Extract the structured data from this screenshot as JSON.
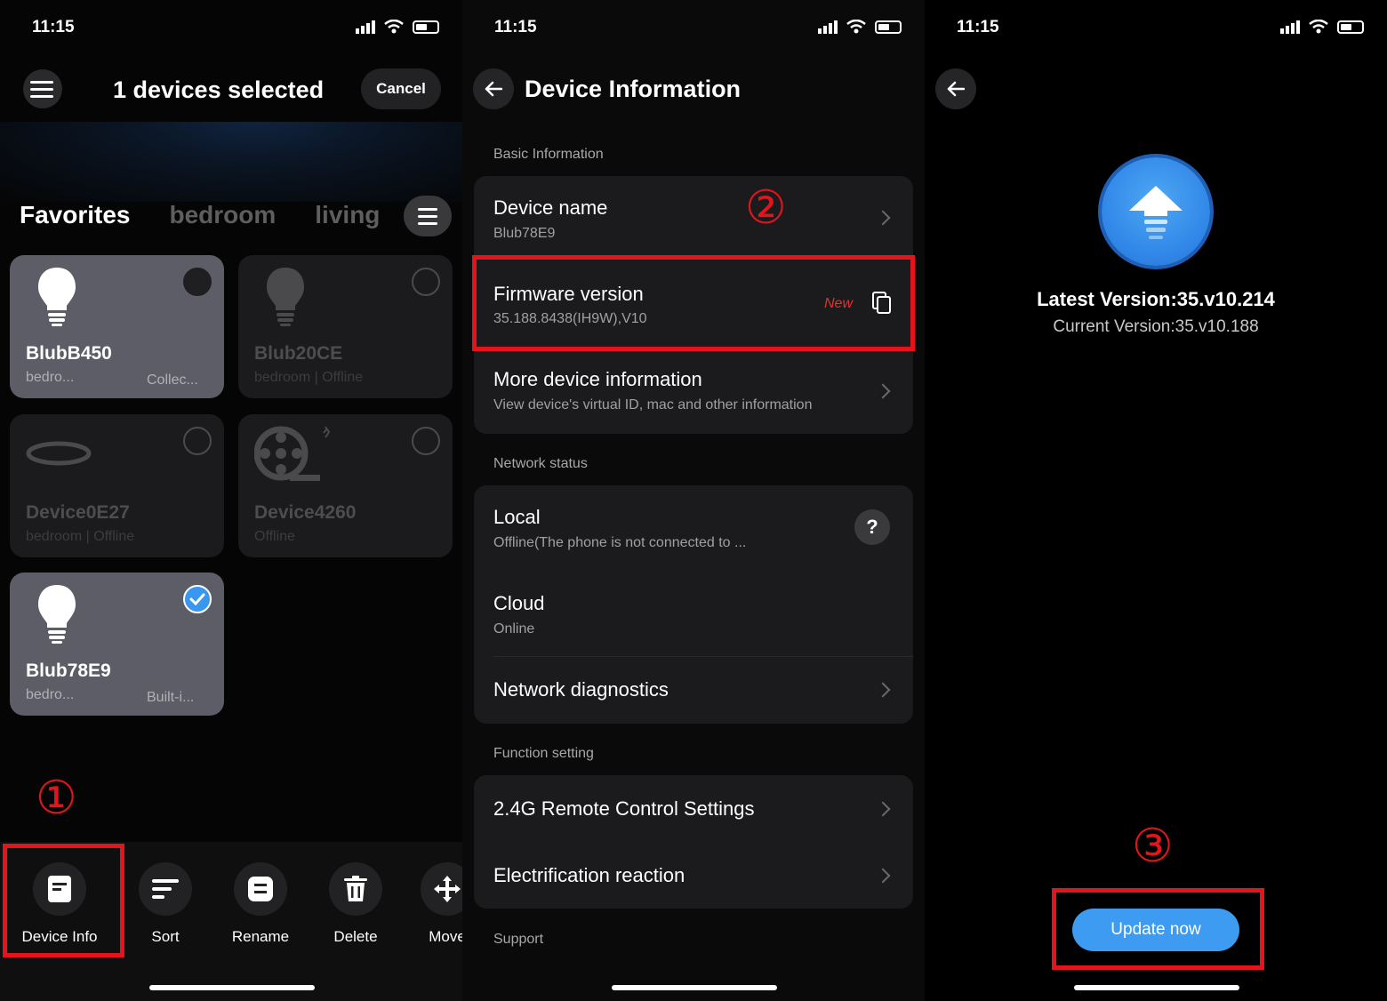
{
  "status_bar": {
    "time": "11:15"
  },
  "screen1": {
    "title": "1 devices selected",
    "cancel_label": "Cancel",
    "tabs": [
      "Favorites",
      "bedroom",
      "living"
    ],
    "devices": [
      {
        "name": "BlubB450",
        "sub": "bedro...",
        "sub2": "Collec..."
      },
      {
        "name": "Blub20CE",
        "sub": "bedroom | Offline"
      },
      {
        "name": "Device0E27",
        "sub": "bedroom | Offline"
      },
      {
        "name": "Device4260",
        "sub": "Offline"
      },
      {
        "name": "Blub78E9",
        "sub": "bedro...",
        "sub2": "Built-i..."
      }
    ],
    "actions": [
      "Device Info",
      "Sort",
      "Rename",
      "Delete",
      "Move"
    ],
    "step_marker": "①"
  },
  "screen2": {
    "title": "Device Information",
    "sections": {
      "basic": "Basic Information",
      "network": "Network status",
      "function": "Function setting",
      "support": "Support"
    },
    "device_name": {
      "title": "Device name",
      "value": "Blub78E9"
    },
    "firmware": {
      "title": "Firmware version",
      "value": "35.188.8438(IH9W),V10",
      "badge": "New"
    },
    "more_info": {
      "title": "More device information",
      "desc": "View device's virtual ID, mac and other information"
    },
    "local": {
      "title": "Local",
      "desc": "Offline(The phone is not connected to ...",
      "help": "?"
    },
    "cloud": {
      "title": "Cloud",
      "desc": "Online"
    },
    "diagnostics": {
      "title": "Network diagnostics"
    },
    "remote": {
      "title": "2.4G Remote Control Settings"
    },
    "electrification": {
      "title": "Electrification reaction"
    },
    "step_marker": "②"
  },
  "screen3": {
    "latest": "Latest Version:35.v10.214",
    "current": "Current Version:35.v10.188",
    "update_label": "Update now",
    "step_marker": "③"
  },
  "colors": {
    "highlight": "#e3141b",
    "accent": "#3d9bf1",
    "new_badge": "#e3322f"
  }
}
